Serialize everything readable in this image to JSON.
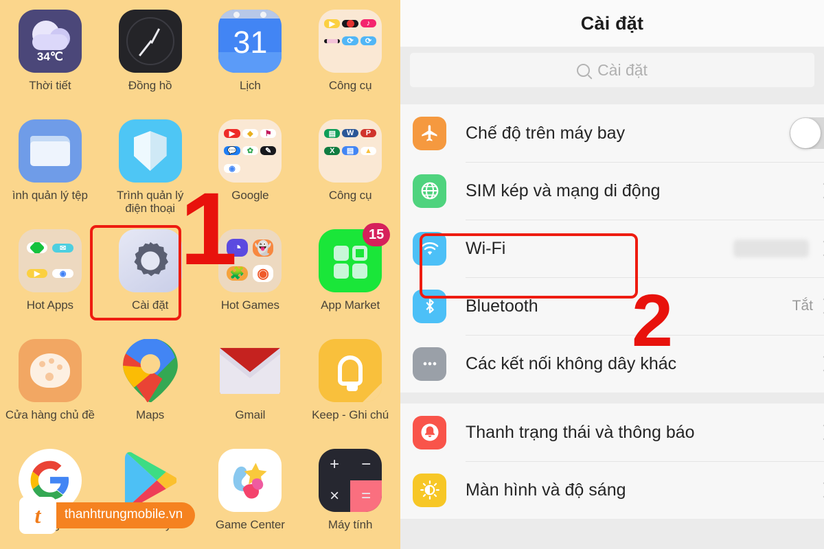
{
  "home": {
    "apps": [
      {
        "label": "Thời tiết",
        "icon": "weather-icon",
        "value": "34℃"
      },
      {
        "label": "Đồng hồ",
        "icon": "clock-icon"
      },
      {
        "label": "Lịch",
        "icon": "calendar-icon",
        "value": "31"
      },
      {
        "label": "Công cụ",
        "icon": "tools-folder-icon"
      },
      {
        "label": "ình quản lý tệp",
        "icon": "file-manager-icon"
      },
      {
        "label": "Trình quản lý điện thoại",
        "icon": "phone-manager-icon"
      },
      {
        "label": "Google",
        "icon": "google-folder-icon"
      },
      {
        "label": "Công cụ",
        "icon": "office-folder-icon"
      },
      {
        "label": "Hot Apps",
        "icon": "hot-apps-folder-icon"
      },
      {
        "label": "Cài đặt",
        "icon": "settings-gear-icon"
      },
      {
        "label": "Hot Games",
        "icon": "hot-games-folder-icon"
      },
      {
        "label": "App Market",
        "icon": "app-market-icon",
        "badge": "15"
      },
      {
        "label": "Cửa hàng chủ đề",
        "icon": "theme-store-icon"
      },
      {
        "label": "Maps",
        "icon": "maps-icon"
      },
      {
        "label": "Gmail",
        "icon": "gmail-icon"
      },
      {
        "label": "Keep - Ghi chú",
        "icon": "keep-notes-icon"
      },
      {
        "label": "Google",
        "icon": "google-search-icon"
      },
      {
        "label": "CH Play",
        "icon": "play-store-icon"
      },
      {
        "label": "Game Center",
        "icon": "game-center-icon"
      },
      {
        "label": "Máy tính",
        "icon": "calculator-icon"
      }
    ],
    "annotations": {
      "step1": "1",
      "highlight_target": "Cài đặt"
    },
    "watermark": {
      "logo_letter": "t",
      "text": "thanhtrungmobile.vn"
    }
  },
  "settings": {
    "title": "Cài đặt",
    "search": {
      "placeholder": "Cài đặt",
      "icon": "search-icon"
    },
    "groups": [
      {
        "rows": [
          {
            "label": "Chế độ trên máy bay",
            "icon": "airplane-icon",
            "icon_color": "#f5993f",
            "control": "toggle",
            "toggle_on": false
          },
          {
            "label": "SIM kép và mạng di động",
            "icon": "globe-icon",
            "icon_color": "#4fd37e",
            "control": "chevron"
          },
          {
            "label": "Wi-Fi",
            "icon": "wifi-icon",
            "icon_color": "#4cc0f7",
            "control": "blurred-value"
          },
          {
            "label": "Bluetooth",
            "icon": "bluetooth-icon",
            "icon_color": "#4cc0f7",
            "control": "chevron",
            "value": "Tắt"
          },
          {
            "label": "Các kết nối không dây khác",
            "icon": "more-dots-icon",
            "icon_color": "#9aa0a8",
            "control": "chevron"
          }
        ]
      },
      {
        "rows": [
          {
            "label": "Thanh trạng thái và thông báo",
            "icon": "bell-icon",
            "icon_color": "#f9544a",
            "control": "chevron"
          },
          {
            "label": "Màn hình và độ sáng",
            "icon": "brightness-icon",
            "icon_color": "#f7c726",
            "control": "chevron"
          }
        ]
      }
    ],
    "annotations": {
      "step2": "2",
      "highlight_target": "Wi-Fi"
    }
  },
  "colors": {
    "home_background": "#fbd68c",
    "annotation_red": "#e8120c",
    "settings_background": "#ebebeb",
    "watermark_orange": "#f58220"
  }
}
